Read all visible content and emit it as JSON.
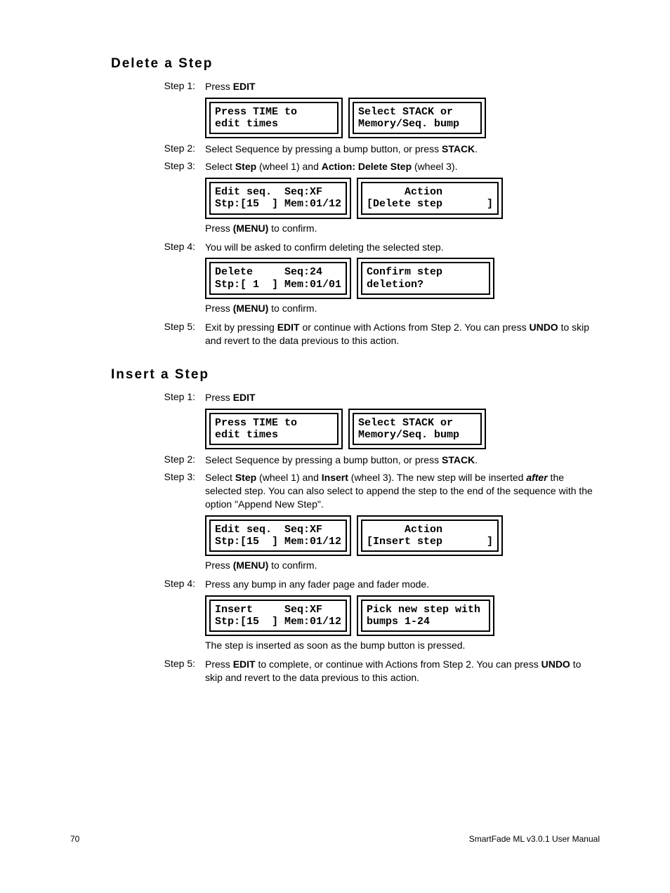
{
  "sections": {
    "delete": {
      "heading": "Delete a Step",
      "step1_label": "Step 1:",
      "step1_pre": "Press ",
      "step1_bold": "EDIT",
      "lcd1_left": "Press TIME to\nedit times",
      "lcd1_right": "Select STACK or\nMemory/Seq. bump",
      "step2_label": "Step 2:",
      "step2_pre": "Select Sequence by pressing a bump button, or press ",
      "step2_bold": "STACK",
      "step2_post": ".",
      "step3_label": "Step 3:",
      "step3_pre": "Select ",
      "step3_b1": "Step",
      "step3_mid1": " (wheel 1) and ",
      "step3_b2": "Action: Delete Step",
      "step3_post": " (wheel 3).",
      "lcd2_left": "Edit seq.  Seq:XF\nStp:[15  ] Mem:01/12",
      "lcd2_right": "      Action\n[Delete step       ]",
      "after2_pre": "Press ",
      "after2_bold": "(MENU)",
      "after2_post": " to confirm.",
      "step4_label": "Step 4:",
      "step4_text": "You will be asked to confirm deleting the selected step.",
      "lcd3_left": "Delete     Seq:24\nStp:[ 1  ] Mem:01/01",
      "lcd3_right": "Confirm step\ndeletion?",
      "after3_pre": "Press ",
      "after3_bold": "(MENU)",
      "after3_post": " to confirm.",
      "step5_label": "Step 5:",
      "step5_pre": "Exit by pressing ",
      "step5_b1": "EDIT",
      "step5_mid": " or continue with Actions from Step 2. You can press ",
      "step5_b2": "UNDO",
      "step5_post": " to skip and revert to the data previous to this action."
    },
    "insert": {
      "heading": "Insert a Step",
      "step1_label": "Step 1:",
      "step1_pre": "Press ",
      "step1_bold": "EDIT",
      "lcd1_left": "Press TIME to\nedit times",
      "lcd1_right": "Select STACK or\nMemory/Seq. bump",
      "step2_label": "Step 2:",
      "step2_pre": "Select Sequence by pressing a bump button, or press ",
      "step2_bold": "STACK",
      "step2_post": ".",
      "step3_label": "Step 3:",
      "step3_pre": "Select ",
      "step3_b1": "Step",
      "step3_mid1": " (wheel 1) and ",
      "step3_b2": "Insert",
      "step3_mid2": " (wheel 3). The new step will be inserted ",
      "step3_italic": "after",
      "step3_post": " the selected step. You can also select to append the step to the end of the sequence with the option \"Append New Step\".",
      "lcd2_left": "Edit seq.  Seq:XF\nStp:[15  ] Mem:01/12",
      "lcd2_right": "      Action\n[Insert step       ]",
      "after2_pre": "Press ",
      "after2_bold": "(MENU)",
      "after2_post": " to confirm.",
      "step4_label": "Step 4:",
      "step4_text": "Press any bump in any fader page and fader mode.",
      "lcd3_left": "Insert     Seq:XF\nStp:[15  ] Mem:01/12",
      "lcd3_right": "Pick new step with\nbumps 1-24",
      "after3_text": "The step is inserted as soon as the bump button is pressed.",
      "step5_label": "Step 5:",
      "step5_pre": "Press ",
      "step5_b1": "EDIT",
      "step5_mid": " to complete, or continue with Actions from Step 2. You can press ",
      "step5_b2": "UNDO",
      "step5_post": " to skip and revert to the data previous to this action."
    }
  },
  "footer": {
    "page": "70",
    "title": "SmartFade ML v3.0.1 User Manual"
  }
}
